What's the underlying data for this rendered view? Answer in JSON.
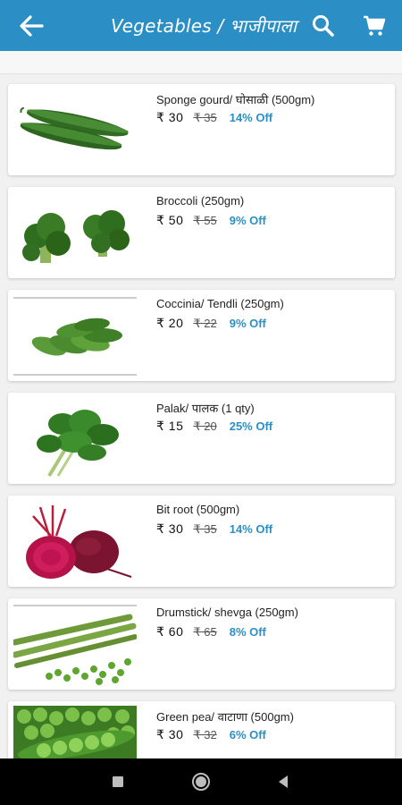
{
  "header": {
    "title": "Vegetables / भाजीपाला",
    "back_icon": "arrow-left-icon",
    "search_icon": "search-icon",
    "cart_icon": "cart-icon",
    "color": "#2b8fc6"
  },
  "products": [
    {
      "name": "Sponge gourd/ घोसाळी (500gm)",
      "price": "₹ 30",
      "mrp": "₹ 35",
      "off": "14% Off",
      "image": "sponge-gourd"
    },
    {
      "name": "Broccoli (250gm)",
      "price": "₹ 50",
      "mrp": "₹ 55",
      "off": "9% Off",
      "image": "broccoli"
    },
    {
      "name": "Coccinia/ Tendli (250gm)",
      "price": "₹ 20",
      "mrp": "₹ 22",
      "off": "9% Off",
      "image": "tendli"
    },
    {
      "name": "Palak/ पालक (1 qty)",
      "price": "₹ 15",
      "mrp": "₹ 20",
      "off": "25% Off",
      "image": "spinach"
    },
    {
      "name": "Bit root (500gm)",
      "price": "₹ 30",
      "mrp": "₹ 35",
      "off": "14% Off",
      "image": "beetroot"
    },
    {
      "name": "Drumstick/ shevga (250gm)",
      "price": "₹ 60",
      "mrp": "₹ 65",
      "off": "8% Off",
      "image": "drumstick"
    },
    {
      "name": "Green pea/ वाटाणा (500gm)",
      "price": "₹ 30",
      "mrp": "₹ 32",
      "off": "6% Off",
      "image": "green-pea"
    }
  ],
  "navbar": {
    "recent_icon": "square-recents-icon",
    "home_icon": "circle-home-icon",
    "back_icon": "triangle-back-icon"
  }
}
